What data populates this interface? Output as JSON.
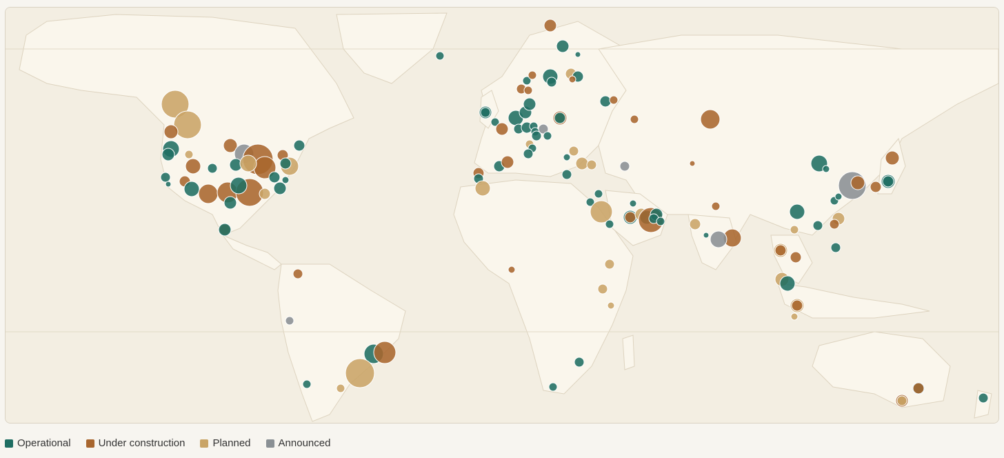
{
  "map": {
    "type": "bubble-map",
    "projection": "world",
    "categories": [
      {
        "key": "operational",
        "label": "Operational",
        "color": "#1f6e62"
      },
      {
        "key": "under_construction",
        "label": "Under construction",
        "color": "#a8662e"
      },
      {
        "key": "planned",
        "label": "Planned",
        "color": "#c9a466"
      },
      {
        "key": "announced",
        "label": "Announced",
        "color": "#8a9094"
      }
    ]
  },
  "legend": {
    "operational": "Operational",
    "under_construction": "Under construction",
    "planned": "Planned",
    "announced": "Announced"
  },
  "colors": {
    "background": "#f7f5f0",
    "ocean": "#f3eee2",
    "land": "#faf6ec",
    "border": "#d9d2c2"
  }
}
